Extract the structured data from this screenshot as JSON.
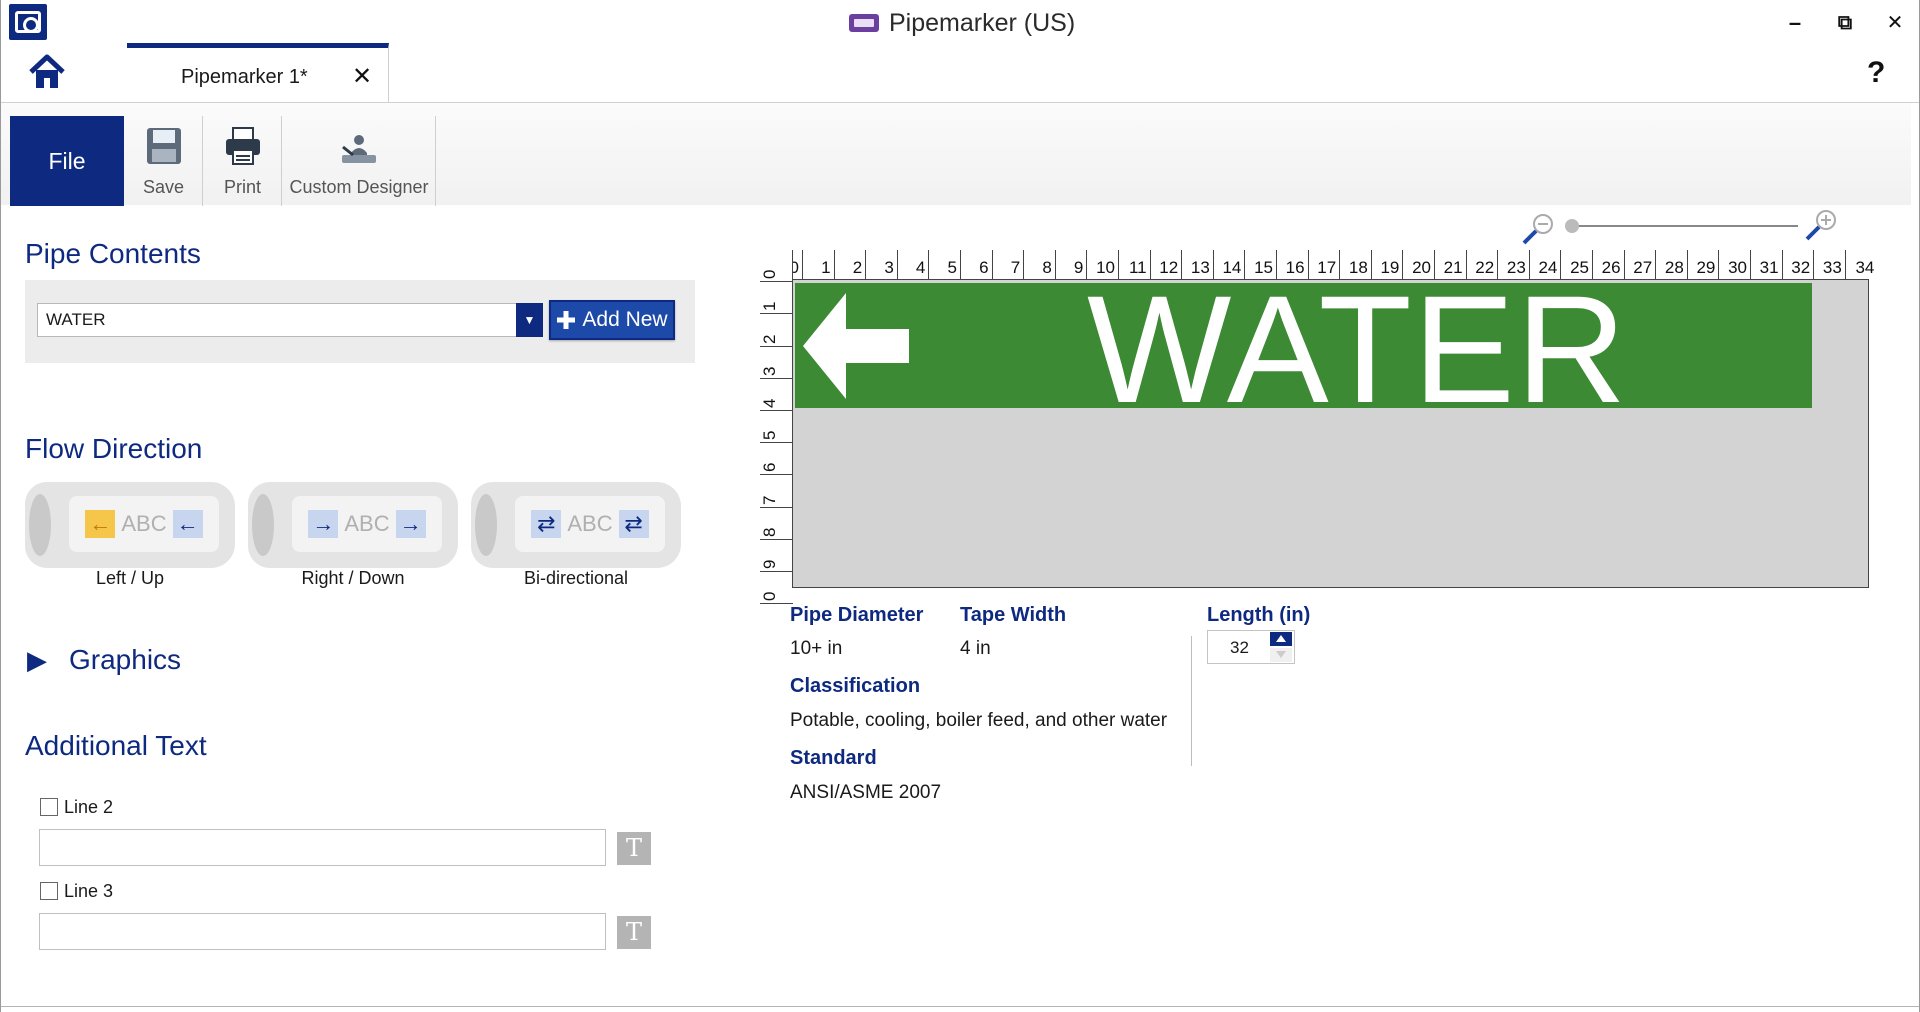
{
  "window": {
    "title": "Pipemarker (US)",
    "minimize": "–",
    "restore": "⧉",
    "close": "✕"
  },
  "tabs": [
    {
      "label": "Pipemarker 1*",
      "close": "✕",
      "active": true
    }
  ],
  "help": "?",
  "ribbon": {
    "file": "File",
    "save": "Save",
    "print": "Print",
    "custom_designer": "Custom Designer"
  },
  "pipe_contents": {
    "title": "Pipe Contents",
    "selected": "WATER",
    "add_new": "Add New"
  },
  "flow_direction": {
    "title": "Flow Direction",
    "options": [
      {
        "label": "Left / Up",
        "abc": "ABC",
        "arrow": "←",
        "selected": true
      },
      {
        "label": "Right / Down",
        "abc": "ABC",
        "arrow": "→",
        "selected": false
      },
      {
        "label": "Bi-directional",
        "abc": "ABC",
        "arrow": "⇄",
        "selected": false
      }
    ]
  },
  "graphics": {
    "title": "Graphics",
    "expander": "▶"
  },
  "additional_text": {
    "title": "Additional Text",
    "lines": [
      {
        "label": "Line 2",
        "checked": false,
        "value": "",
        "format_icon": "T"
      },
      {
        "label": "Line 3",
        "checked": false,
        "value": "",
        "format_icon": "T"
      }
    ]
  },
  "zoom": {
    "level": 0.0
  },
  "preview": {
    "ruler_top": [
      "0",
      "1",
      "2",
      "3",
      "4",
      "5",
      "6",
      "7",
      "8",
      "9",
      "10",
      "11",
      "12",
      "13",
      "14",
      "15",
      "16",
      "17",
      "18",
      "19",
      "20",
      "21",
      "22",
      "23",
      "24",
      "25",
      "26",
      "27",
      "28",
      "29",
      "30",
      "31",
      "32",
      "33",
      "34"
    ],
    "ruler_left": [
      "0",
      "1",
      "2",
      "3",
      "4",
      "5",
      "6",
      "7",
      "8",
      "9",
      "0"
    ],
    "marker_text": "WATER",
    "marker_color": "#3c8a34",
    "marker_arrow": "left-arrow"
  },
  "details": {
    "pipe_diameter": {
      "label": "Pipe Diameter",
      "value": "10+  in"
    },
    "tape_width": {
      "label": "Tape Width",
      "value": "4  in"
    },
    "classification": {
      "label": "Classification",
      "value": "Potable, cooling, boiler feed, and other water"
    },
    "standard": {
      "label": "Standard",
      "value": "ANSI/ASME 2007"
    },
    "length": {
      "label": "Length (in)",
      "value": "32"
    }
  },
  "colors": {
    "accent": "#0e2a80",
    "marker_green": "#3c8a34"
  }
}
